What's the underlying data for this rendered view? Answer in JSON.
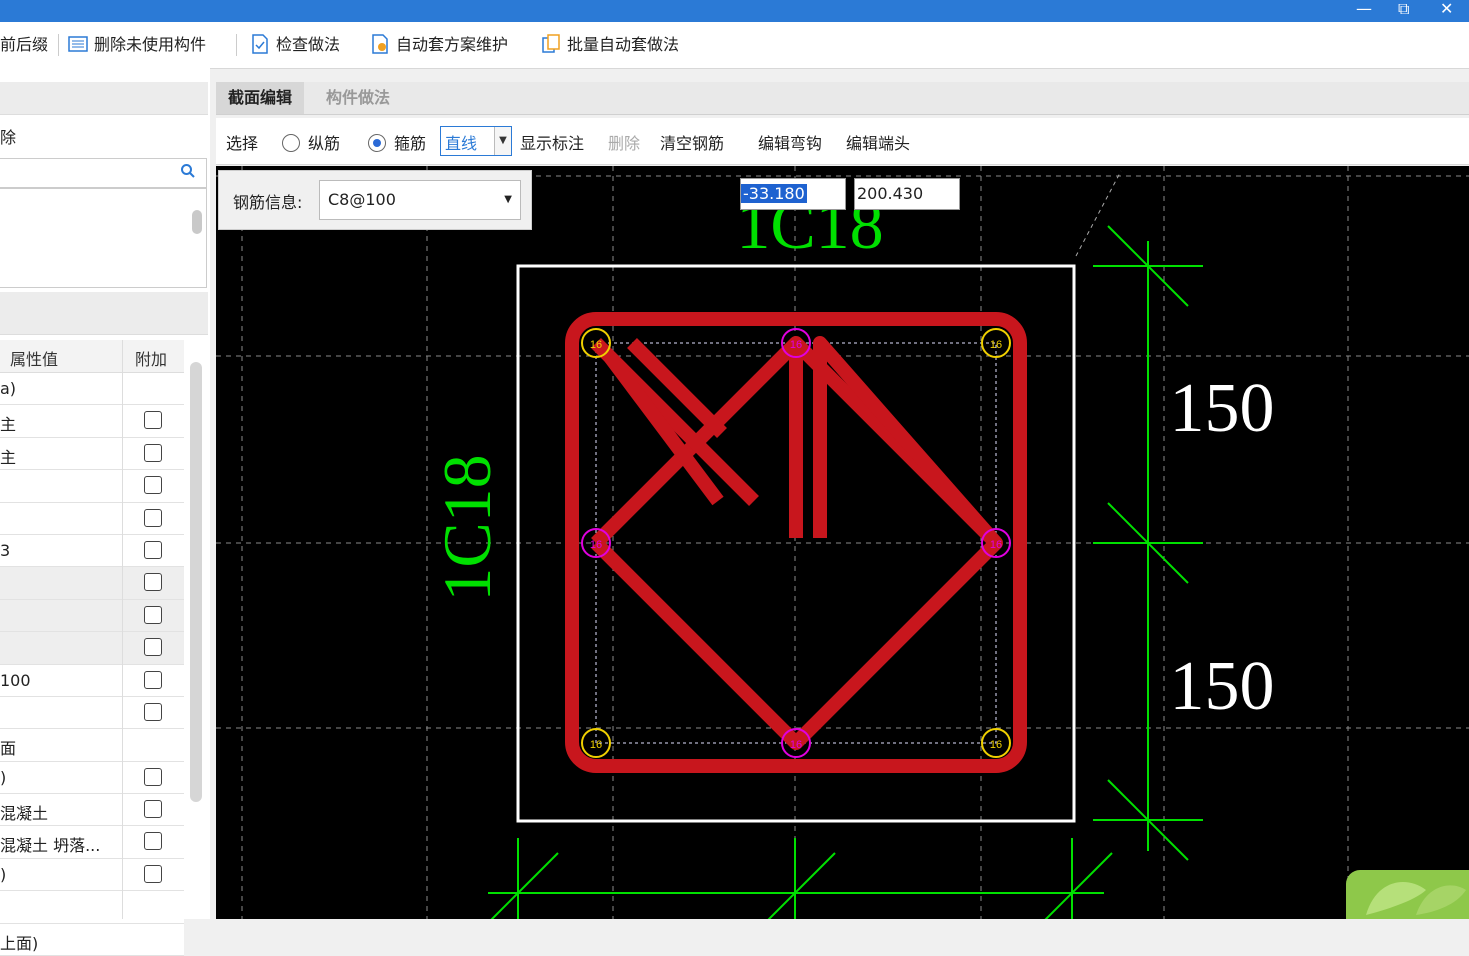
{
  "window": {
    "min_label": "—",
    "max_label": "⧉",
    "close_label": "✕"
  },
  "toolbar": {
    "items": [
      {
        "label": "前后缀"
      },
      {
        "label": "删除未使用构件"
      },
      {
        "label": "检查做法"
      },
      {
        "label": "自动套方案维护"
      },
      {
        "label": "批量自动套做法"
      }
    ]
  },
  "left_panel": {
    "delete_label": "除",
    "prop_header_value": "属性值",
    "prop_header_extra": "附加",
    "rows": [
      "a)",
      "主",
      "主",
      "",
      "",
      "3",
      "",
      "",
      "",
      "100",
      "",
      "面",
      ")",
      "混凝土",
      "混凝土 坍落...",
      ")",
      "",
      "上面)"
    ]
  },
  "editor": {
    "tabs": [
      {
        "label": "截面编辑"
      },
      {
        "label": "构件做法"
      }
    ],
    "tools": {
      "select": "选择",
      "longitudinal": "纵筋",
      "stirrup": "箍筋",
      "line_type": "直线",
      "show_marks": "显示标注",
      "delete": "删除",
      "clear_rebar": "清空钢筋",
      "edit_hook": "编辑弯钩",
      "edit_end": "编辑端头"
    },
    "rebar_info_label": "钢筋信息:",
    "rebar_info_value": "C8@100",
    "coord_x": "-33.180",
    "coord_y": "200.430"
  },
  "drawing": {
    "top_label": "1C18",
    "side_label": "1C18",
    "dim_upper": "150",
    "dim_lower": "150",
    "bar_label": "16",
    "colors": {
      "stirrup": "#c8161d",
      "dimension": "#00e000",
      "corner_bar": "#f0d000",
      "middle_bar": "#e000e0",
      "outline": "#ffffff"
    }
  }
}
